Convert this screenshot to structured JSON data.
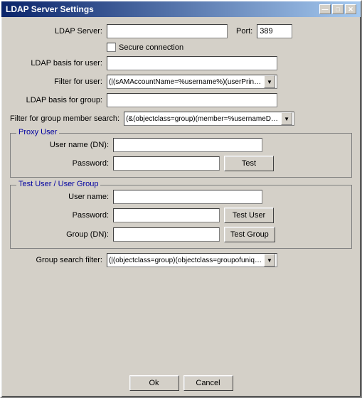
{
  "window": {
    "title": "LDAP Server Settings",
    "close_btn": "✕",
    "minimize_btn": "—",
    "maximize_btn": "□"
  },
  "form": {
    "ldap_server_label": "LDAP Server:",
    "ldap_server_value": "",
    "port_label": "Port:",
    "port_value": "389",
    "secure_label": "Secure connection",
    "ldap_basis_user_label": "LDAP basis for user:",
    "ldap_basis_user_value": "",
    "filter_user_label": "Filter for user:",
    "filter_user_value": "(|(sAMAccountName=%username%)(userPrincipalName=%",
    "ldap_basis_group_label": "LDAP basis for group:",
    "ldap_basis_group_value": "",
    "filter_group_label": "Filter for group member search:",
    "filter_group_value": "(&(objectclass=group)(member=%usernameDN%))",
    "proxy_section_label": "Proxy User",
    "username_dn_label": "User name (DN):",
    "username_dn_value": "",
    "password_label": "Password:",
    "password_value": "",
    "test_btn": "Test",
    "test_user_section_label": "Test User / User Group",
    "test_username_label": "User name:",
    "test_username_value": "",
    "test_password_label": "Password:",
    "test_password_value": "",
    "test_user_btn": "Test User",
    "group_dn_label": "Group (DN):",
    "group_dn_value": "",
    "test_group_btn": "Test Group",
    "group_search_label": "Group search filter:",
    "group_search_value": "(|(objectclass=group)(objectclass=groupofuniquenames)",
    "ok_btn": "Ok",
    "cancel_btn": "Cancel"
  }
}
